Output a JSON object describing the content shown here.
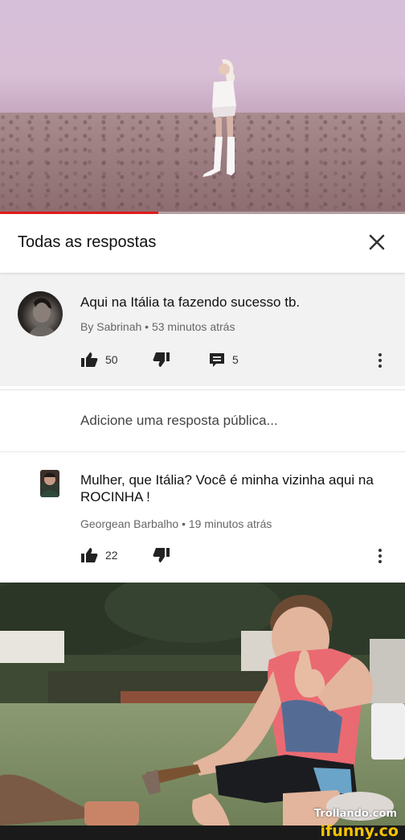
{
  "video": {
    "progress_percent": 39,
    "progress_color": "#e01b1b"
  },
  "header": {
    "title": "Todas as respostas",
    "close_icon": "close-icon"
  },
  "parent_comment": {
    "text": "Aqui na Itália ta fazendo sucesso tb.",
    "meta": "By Sabrinah • 53 minutos atrás",
    "likes": "50",
    "replies": "5"
  },
  "add_reply": {
    "placeholder": "Adicione uma resposta pública..."
  },
  "reply_comment": {
    "text": "Mulher, que Itália? Você é minha vizinha aqui na ROCINHA !",
    "meta": "Georgean Barbalho • 19 minutos atrás",
    "likes": "22"
  },
  "watermarks": {
    "trollando": "Trollando.com",
    "ifunny": "ifunny.co"
  },
  "colors": {
    "accent_red": "#e01b1b",
    "ifunny_yellow": "#f5c400"
  }
}
